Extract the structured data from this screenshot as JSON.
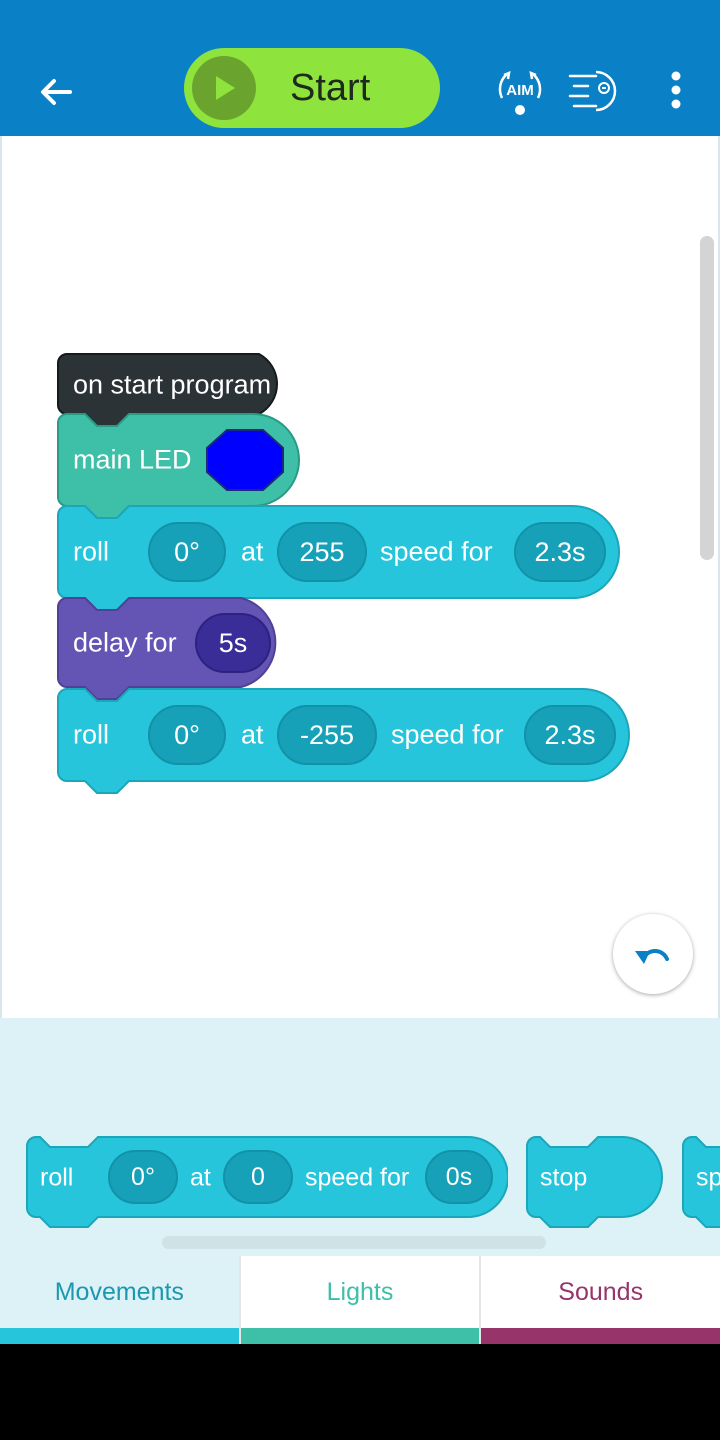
{
  "header": {
    "start_label": "Start",
    "aim_label": "AIM"
  },
  "program": {
    "hat_label": "on start program",
    "led_block": {
      "label": "main LED",
      "color": "#0000ff"
    },
    "roll1": {
      "label": "roll",
      "heading": "0°",
      "at": "at",
      "speed": "255",
      "speed_for": "speed for",
      "duration": "2.3s"
    },
    "delay": {
      "label": "delay for",
      "duration": "5s"
    },
    "roll2": {
      "label": "roll",
      "heading": "0°",
      "at": "at",
      "speed": "-255",
      "speed_for": "speed for",
      "duration": "2.3s"
    }
  },
  "palette": {
    "roll": {
      "label": "roll",
      "heading": "0°",
      "at": "at",
      "speed": "0",
      "speed_for": "speed for",
      "duration": "0s"
    },
    "stop_label": "stop",
    "partial_label": "sp"
  },
  "tabs": [
    {
      "label": "Movements",
      "active": true
    },
    {
      "label": "Lights",
      "active": false
    },
    {
      "label": "Sounds",
      "active": false
    }
  ],
  "colors": {
    "header_blue": "#0a80c6",
    "start_green": "#8ee43c",
    "movement_cyan": "#26c5dc",
    "light_teal": "#3dbfa8",
    "control_purple": "#6454b4",
    "sound_magenta": "#973469",
    "event_dark": "#2b3336"
  }
}
